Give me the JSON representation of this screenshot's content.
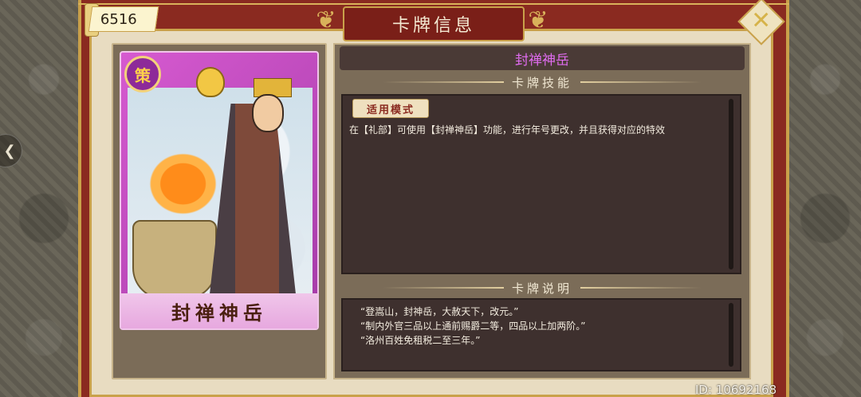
{
  "header": {
    "title": "卡牌信息",
    "currency_value": "6516"
  },
  "card": {
    "badge": "策",
    "name_art": "封禅神岳"
  },
  "detail": {
    "title": "封禅神岳",
    "skill_section": "卡牌技能",
    "mode_tag": "适用模式",
    "skill_text": "在【礼部】可使用【封禅神岳】功能，进行年号更改，并且获得对应的特效",
    "desc_section": "卡牌说明",
    "desc_lines": [
      "“登嵩山，封神岳，大赦天下，改元。”",
      "“制内外官三品以上通前赐爵二等，四品以上加两阶。”",
      "“洛州百姓免租税二至三年。”"
    ]
  },
  "footer": {
    "id_text": "ID: 10692168"
  },
  "icons": {
    "close": "close-icon",
    "side_arrow": "arrow-icon"
  },
  "colors": {
    "frame": "#8a2a20",
    "gold": "#c9a14a",
    "card_title": "#e06cf0"
  }
}
